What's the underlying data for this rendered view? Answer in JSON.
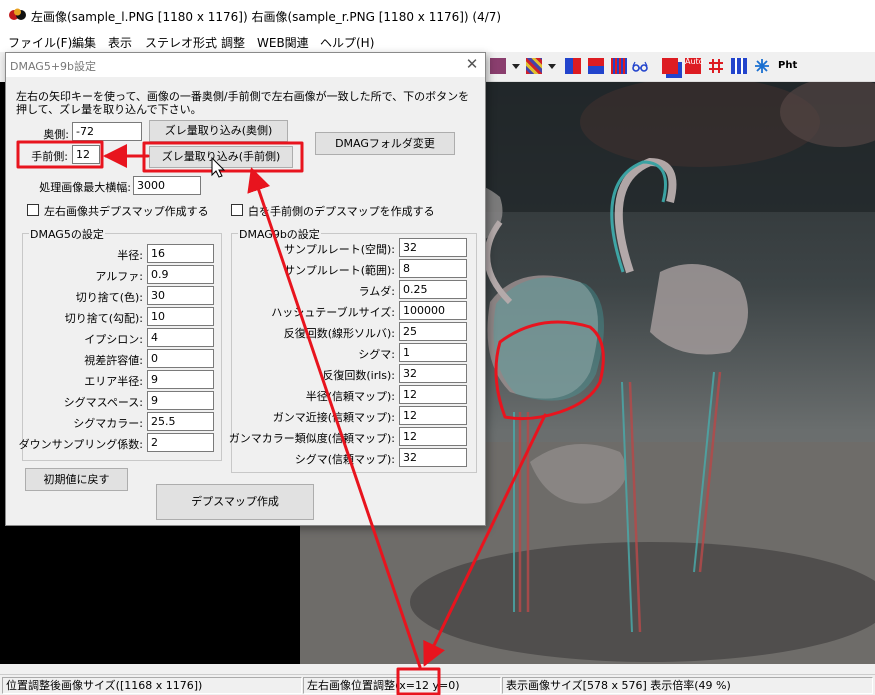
{
  "window": {
    "title": "左画像(sample_l.PNG [1180 x 1176]) 右画像(sample_r.PNG [1180 x 1176]) (4/7)"
  },
  "menu": [
    "ファイル(F)",
    "編集",
    "表示",
    "ステレオ形式",
    "調整",
    "WEB関連",
    "ヘルプ(H)"
  ],
  "toolbar": {
    "auto_label": "Auto",
    "pht_label": "Pht",
    "icons": [
      "pattern-icon",
      "mosaic-icon",
      "red-blue-icon",
      "red-blue-split-icon",
      "interlace-icon",
      "glasses-icon",
      "red-cyan-overlap-icon",
      "auto-align-icon",
      "grid-icon",
      "color-bars-icon",
      "snowflake-icon",
      "photo-icon"
    ]
  },
  "dialog": {
    "title": "DMAG5+9b設定",
    "instruction_line1": "左右の矢印キーを使って、画像の一番奥側/手前側で左右画像が一致した所で、下のボタンを",
    "instruction_line2": "押して、ズレ量を取り込んで下さい。",
    "far_label": "奥側:",
    "far_value": "-72",
    "far_button": "ズレ量取り込み(奥側)",
    "near_label": "手前側:",
    "near_value": "12",
    "near_button": "ズレ量取り込み(手前側)",
    "dmag_folder_button": "DMAGフォルダ変更",
    "max_width_label": "処理画像最大横幅:",
    "max_width_value": "3000",
    "checkbox_both": "左右画像共デプスマップ作成する",
    "checkbox_white_near": "白を手前側のデプスマップを作成する",
    "dmag5": {
      "title": "DMAG5の設定",
      "fields": [
        {
          "label": "半径:",
          "value": "16"
        },
        {
          "label": "アルファ:",
          "value": "0.9"
        },
        {
          "label": "切り捨て(色):",
          "value": "30"
        },
        {
          "label": "切り捨て(勾配):",
          "value": "10"
        },
        {
          "label": "イプシロン:",
          "value": "4"
        },
        {
          "label": "視差許容値:",
          "value": "0"
        },
        {
          "label": "エリア半径:",
          "value": "9"
        },
        {
          "label": "シグマスペース:",
          "value": "9"
        },
        {
          "label": "シグマカラー:",
          "value": "25.5"
        },
        {
          "label": "ダウンサンプリング係数:",
          "value": "2"
        }
      ]
    },
    "dmag9b": {
      "title": "DMAG9bの設定",
      "fields": [
        {
          "label": "サンプルレート(空間):",
          "value": "32"
        },
        {
          "label": "サンプルレート(範囲):",
          "value": "8"
        },
        {
          "label": "ラムダ:",
          "value": "0.25"
        },
        {
          "label": "ハッシュテーブルサイズ:",
          "value": "100000"
        },
        {
          "label": "反復回数(線形ソルバ):",
          "value": "25"
        },
        {
          "label": "シグマ:",
          "value": "1"
        },
        {
          "label": "反復回数(irls):",
          "value": "32"
        },
        {
          "label": "半径(信頼マップ):",
          "value": "12"
        },
        {
          "label": "ガンマ近接(信頼マップ):",
          "value": "12"
        },
        {
          "label": "ガンマカラー類似度(信頼マップ):",
          "value": "12"
        },
        {
          "label": "シグマ(信頼マップ):",
          "value": "32"
        }
      ]
    },
    "reset_button": "初期値に戻す",
    "create_button": "デプスマップ作成"
  },
  "status": {
    "adjusted_size": "位置調整後画像サイズ([1168 x 1176])",
    "left_pos_prefix": "左右画像位置調整(",
    "left_pos_x": "x=12",
    "left_pos_suffix": " y=0)",
    "display_size": "表示画像サイズ[578 x 576] 表示倍率(49 %)"
  },
  "colors": {
    "annotation": "#e8141e",
    "titlebar": "#ffffff",
    "dialog_bg": "#f0f0f0"
  }
}
